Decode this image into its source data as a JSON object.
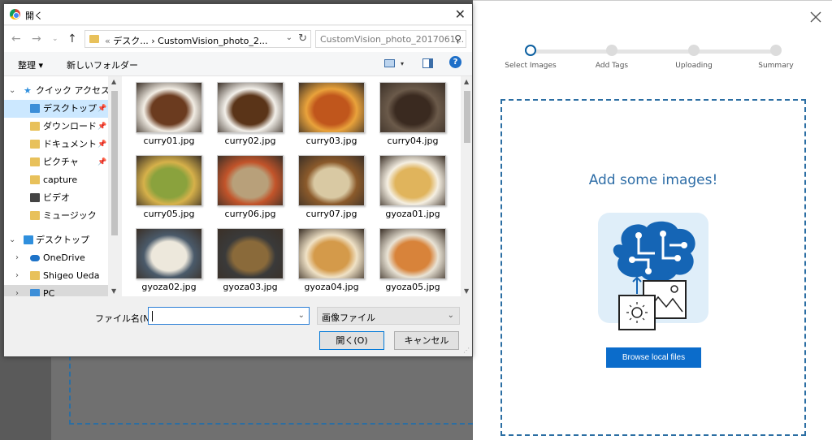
{
  "dialog": {
    "title": "開く",
    "address": {
      "prefix": "«",
      "crumb1": "デスク...",
      "sep": "›",
      "crumb2": "CustomVision_photo_2..."
    },
    "search_placeholder": "CustomVision_photo_2017061...",
    "toolbar": {
      "organize": "整理 ▾",
      "new_folder": "新しいフォルダー"
    },
    "tree": [
      {
        "label": "クイック アクセス",
        "icon": "star-icon",
        "color": "#2f8fdd"
      },
      {
        "label": "デスクトップ",
        "icon": "desktop-folder-icon",
        "color": "#3c8ed8",
        "pinned": true,
        "selected": true
      },
      {
        "label": "ダウンロード",
        "icon": "download-folder-icon",
        "color": "#e8c15b",
        "pinned": true
      },
      {
        "label": "ドキュメント",
        "icon": "documents-folder-icon",
        "color": "#e8c15b",
        "pinned": true
      },
      {
        "label": "ピクチャ",
        "icon": "pictures-folder-icon",
        "color": "#e8c15b",
        "pinned": true
      },
      {
        "label": "capture",
        "icon": "folder-icon",
        "color": "#e8c15b"
      },
      {
        "label": "ビデオ",
        "icon": "videos-folder-icon",
        "color": "#444"
      },
      {
        "label": "ミュージック",
        "icon": "music-folder-icon",
        "color": "#e8c15b"
      },
      {
        "label": "デスクトップ",
        "icon": "desktop-icon",
        "color": "#2f8fdd"
      },
      {
        "label": "OneDrive",
        "icon": "onedrive-icon",
        "color": "#1e73c8"
      },
      {
        "label": "Shigeo Ueda",
        "icon": "user-folder-icon",
        "color": "#e8c15b"
      },
      {
        "label": "PC",
        "icon": "pc-icon",
        "color": "#3c8ed8"
      }
    ],
    "files": [
      {
        "name": "curry01.jpg",
        "c1": "#6b3b1f",
        "c2": "#f2ede4"
      },
      {
        "name": "curry02.jpg",
        "c1": "#5a3418",
        "c2": "#f3f0ea"
      },
      {
        "name": "curry03.jpg",
        "c1": "#c0561c",
        "c2": "#e9a23b"
      },
      {
        "name": "curry04.jpg",
        "c1": "#3a2a20",
        "c2": "#6b5a4a"
      },
      {
        "name": "curry05.jpg",
        "c1": "#8aa23d",
        "c2": "#d6b14a"
      },
      {
        "name": "curry06.jpg",
        "c1": "#b8a07a",
        "c2": "#c2542a"
      },
      {
        "name": "curry07.jpg",
        "c1": "#d9c9a3",
        "c2": "#8b5a2b"
      },
      {
        "name": "gyoza01.jpg",
        "c1": "#e0b45c",
        "c2": "#f5efe2"
      },
      {
        "name": "gyoza02.jpg",
        "c1": "#ede8dc",
        "c2": "#4a5a6a"
      },
      {
        "name": "gyoza03.jpg",
        "c1": "#8a6a3a",
        "c2": "#3a3a3a"
      },
      {
        "name": "gyoza04.jpg",
        "c1": "#d49a4a",
        "c2": "#f0e2c6"
      },
      {
        "name": "gyoza05.jpg",
        "c1": "#d8833a",
        "c2": "#e9e3d5"
      }
    ],
    "file_name_label": "ファイル名(N):",
    "file_name_value": "",
    "file_type": "画像ファイル",
    "open_label": "開く(O)",
    "cancel_label": "キャンセル"
  },
  "panel": {
    "steps": [
      "Select Images",
      "Add Tags",
      "Uploading",
      "Summary"
    ],
    "active_step": 0,
    "heading": "Add some images!",
    "browse_label": "Browse local files",
    "accent": "#0b6ccb"
  }
}
